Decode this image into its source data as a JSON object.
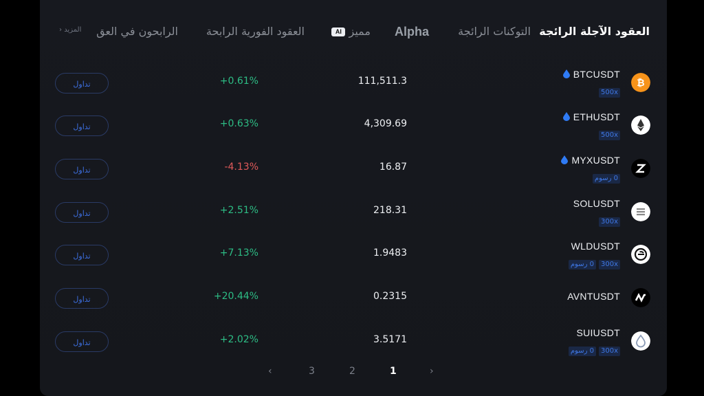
{
  "tabs": {
    "trending_futures": "العقود الآجلة الرائجة",
    "trending_tokens": "التوكنات الرائجة",
    "alpha": "Alpha",
    "featured": "مميز",
    "featured_badge": "AI",
    "spot_gainers": "العقود الفورية الرابحة",
    "gainers": "الرابحون في العق",
    "more": "المزيد"
  },
  "trade_label": "تداول",
  "rows": [
    {
      "symbol": "BTCUSDT",
      "tags": [
        "500x"
      ],
      "price": "111,511.3",
      "change": "+0.61%",
      "direction": "up",
      "coin_icon": "bitcoin-icon",
      "coin_color": "#f7931a",
      "hot": true
    },
    {
      "symbol": "ETHUSDT",
      "tags": [
        "500x"
      ],
      "price": "4,309.69",
      "change": "+0.63%",
      "direction": "up",
      "coin_icon": "ethereum-icon",
      "coin_color": "#ffffff",
      "hot": true
    },
    {
      "symbol": "MYXUSDT",
      "tags": [
        "0 رسوم"
      ],
      "price": "16.87",
      "change": "-4.13%",
      "direction": "down",
      "coin_icon": "myx-icon",
      "coin_color": "#000000",
      "hot": true
    },
    {
      "symbol": "SOLUSDT",
      "tags": [
        "300x"
      ],
      "price": "218.31",
      "change": "+2.51%",
      "direction": "up",
      "coin_icon": "solana-icon",
      "coin_color": "#ffffff",
      "hot": false
    },
    {
      "symbol": "WLDUSDT",
      "tags": [
        "0 رسوم",
        "300x"
      ],
      "price": "1.9483",
      "change": "+7.13%",
      "direction": "up",
      "coin_icon": "worldcoin-icon",
      "coin_color": "#ffffff",
      "hot": false
    },
    {
      "symbol": "AVNTUSDT",
      "tags": [],
      "price": "0.2315",
      "change": "+20.44%",
      "direction": "up",
      "coin_icon": "avantis-icon",
      "coin_color": "#000000",
      "hot": false
    },
    {
      "symbol": "SUIUSDT",
      "tags": [
        "0 رسوم",
        "300x"
      ],
      "price": "3.5171",
      "change": "+2.02%",
      "direction": "up",
      "coin_icon": "sui-icon",
      "coin_color": "#ffffff",
      "hot": false
    }
  ],
  "pagination": {
    "pages": [
      "1",
      "2",
      "3"
    ],
    "current": "1",
    "prev": "‹",
    "next": "›"
  },
  "colors": {
    "up": "#2dbd85",
    "down": "#e05a5a",
    "accent": "#3d6fe0",
    "hot": "#2f7bf5"
  }
}
